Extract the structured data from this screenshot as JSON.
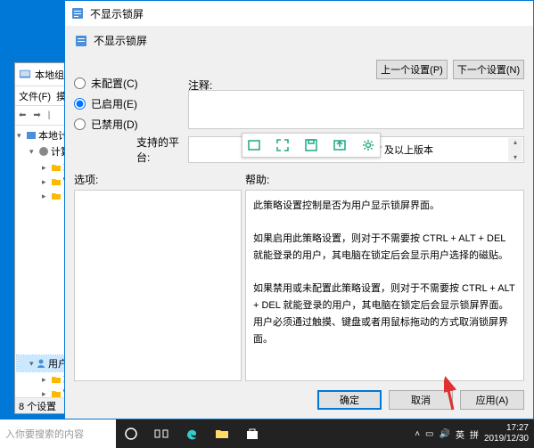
{
  "back_window": {
    "title": "本地组策",
    "menu": "文件(F)",
    "status": "8 个设置",
    "tree": [
      {
        "label": "本地计算机",
        "icon": "computer"
      },
      {
        "label": "计算机",
        "icon": "gear"
      },
      {
        "label": "软",
        "icon": "folder"
      },
      {
        "label": "W",
        "icon": "folder"
      },
      {
        "label": "管",
        "icon": "folder"
      },
      {
        "label": "用户配置",
        "icon": "user"
      },
      {
        "label": "软",
        "icon": "folder"
      },
      {
        "label": "W",
        "icon": "folder"
      },
      {
        "label": "管",
        "icon": "folder"
      }
    ]
  },
  "dialog": {
    "title": "不显示锁屏",
    "subtitle": "不显示锁屏",
    "prev_btn": "上一个设置(P)",
    "next_btn": "下一个设置(N)",
    "radios": {
      "not_configured": "未配置(C)",
      "enabled": "已启用(E)",
      "disabled": "已禁用(D)",
      "selected": "enabled"
    },
    "comment_label": "注释:",
    "platform_label": "支持的平台:",
    "platform_text": "Windows RT 及以上版本",
    "options_label": "选项:",
    "help_label": "帮助:",
    "help_text": {
      "p1": "此策略设置控制是否为用户显示锁屏界面。",
      "p2": "如果启用此策略设置，则对于不需要按 CTRL + ALT + DEL 就能登录的用户，其电脑在锁定后会显示用户选择的磁贴。",
      "p3": "如果禁用或未配置此策略设置，则对于不需要按 CTRL + ALT + DEL 就能登录的用户，其电脑在锁定后会显示锁屏界面。用户必须通过触摸、键盘或者用鼠标拖动的方式取消锁屏界面。"
    },
    "ok_btn": "确定",
    "cancel_btn": "取消",
    "apply_btn": "应用(A)"
  },
  "taskbar": {
    "search_placeholder": "入你要搜索的内容",
    "ime1": "英",
    "ime2": "拼",
    "time": "17:27",
    "date": "2019/12/30"
  }
}
